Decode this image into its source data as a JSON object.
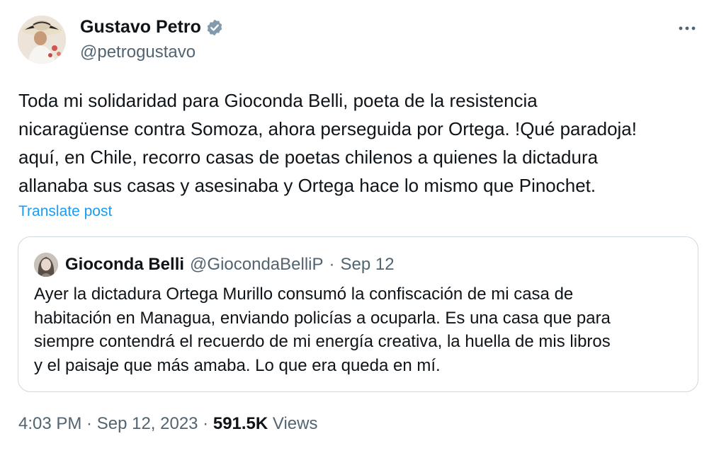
{
  "author": {
    "display_name": "Gustavo Petro",
    "handle": "@petrogustavo",
    "verified_color": "#829aab"
  },
  "tweet": {
    "text_lines": [
      "Toda mi solidaridad para Gioconda Belli, poeta de la resistencia",
      "nicaragüense contra Somoza, ahora perseguida por Ortega. !Qué paradoja!",
      "aquí, en Chile, recorro casas de poetas chilenos a quienes la dictadura",
      "allanaba sus casas y asesinaba y Ortega hace lo mismo que Pinochet."
    ],
    "translate_label": "Translate post"
  },
  "quote": {
    "display_name": "Gioconda Belli",
    "handle": "@GiocondaBelliP",
    "separator": "·",
    "date": "Sep 12",
    "text_lines": [
      "Ayer la dictadura Ortega Murillo consumó la confiscación de mi casa de",
      "habitación en Managua, enviando policías a ocuparla. Es una casa que para",
      "siempre contendrá el recuerdo de mi energía creativa, la huella de mis libros",
      "y el paisaje que más amaba. Lo que era queda en mí."
    ]
  },
  "meta": {
    "time": "4:03 PM",
    "sep1": " · ",
    "date": "Sep 12, 2023",
    "sep2": " · ",
    "views_count": "591.5K",
    "views_label": " Views"
  },
  "colors": {
    "link": "#1d9bf0",
    "secondary_text": "#536471",
    "primary_text": "#0f1419",
    "border": "#cfd9de"
  },
  "icons": {
    "more": "more-horizontal-icon",
    "verified": "verified-badge-icon"
  }
}
